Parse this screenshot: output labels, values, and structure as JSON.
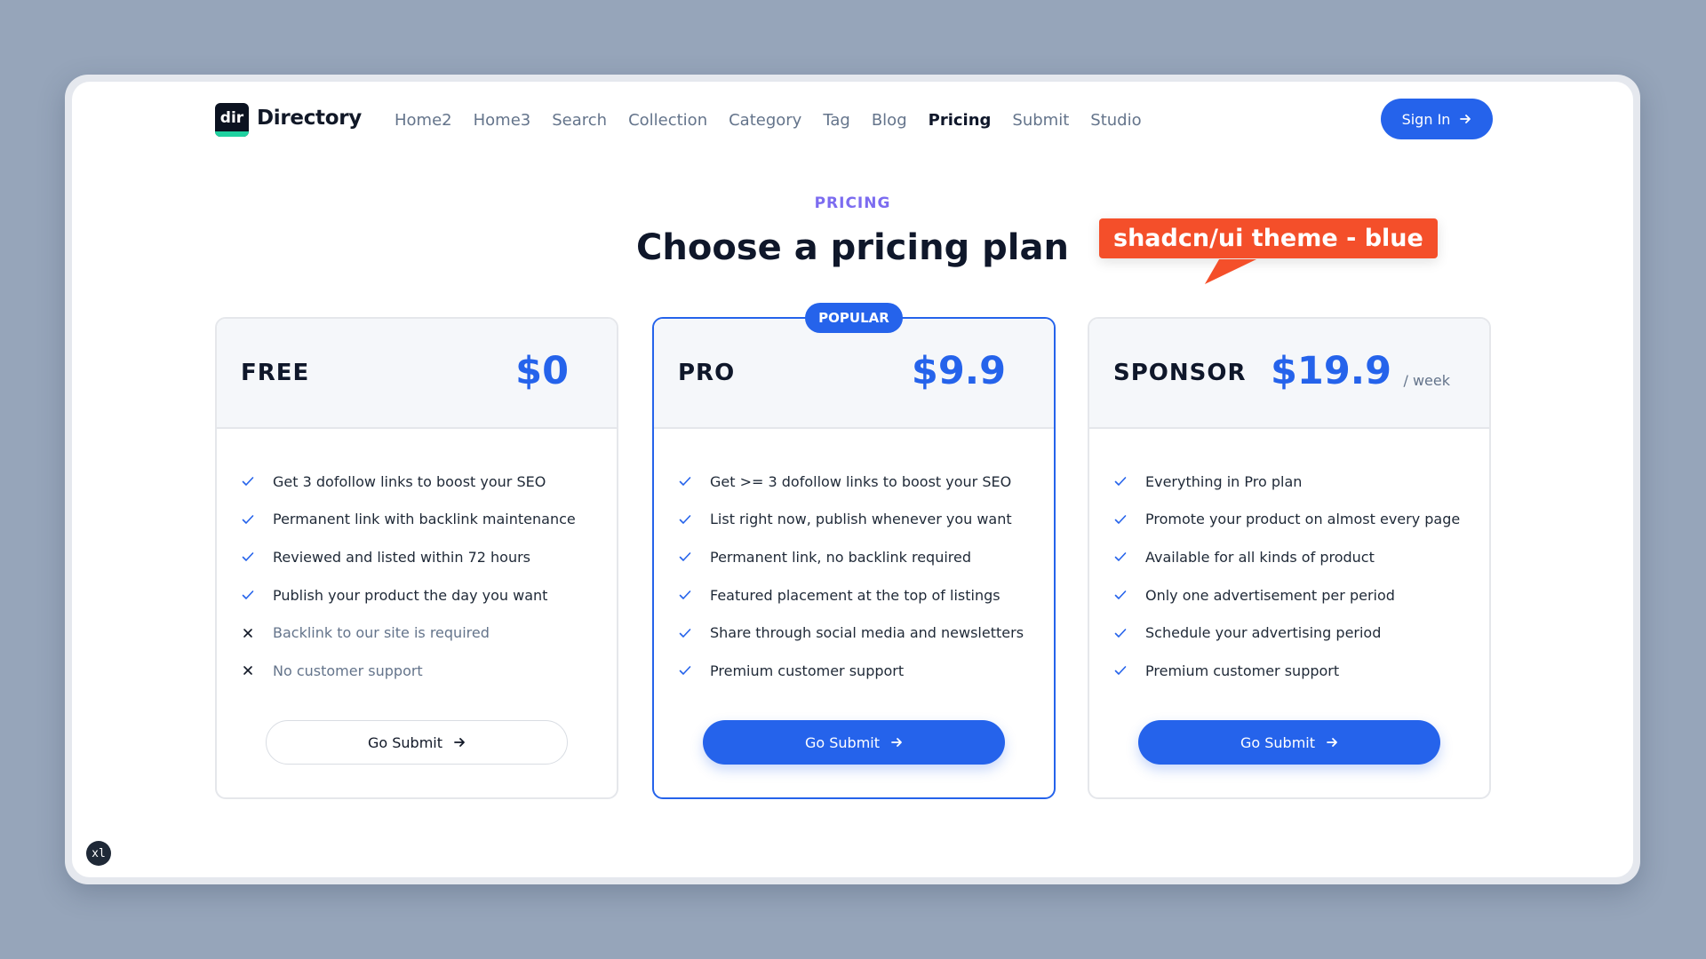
{
  "brand": {
    "logo_text": "dir",
    "name": "Directory"
  },
  "nav": {
    "items": [
      {
        "label": "Home2"
      },
      {
        "label": "Home3"
      },
      {
        "label": "Search"
      },
      {
        "label": "Collection"
      },
      {
        "label": "Category"
      },
      {
        "label": "Tag"
      },
      {
        "label": "Blog"
      },
      {
        "label": "Pricing",
        "active": true
      },
      {
        "label": "Submit"
      },
      {
        "label": "Studio"
      }
    ],
    "signin_label": "Sign In"
  },
  "section": {
    "eyebrow": "PRICING",
    "title": "Choose a pricing plan"
  },
  "callout": "shadcn/ui theme - blue",
  "plans": [
    {
      "name": "FREE",
      "price": "$0",
      "features": [
        {
          "text": "Get 3 dofollow links to boost your SEO",
          "included": true
        },
        {
          "text": "Permanent link with backlink maintenance",
          "included": true
        },
        {
          "text": "Reviewed and listed within 72 hours",
          "included": true
        },
        {
          "text": "Publish your product the day you want",
          "included": true
        },
        {
          "text": "Backlink to our site is required",
          "included": false
        },
        {
          "text": "No customer support",
          "included": false
        }
      ],
      "cta": "Go Submit"
    },
    {
      "name": "PRO",
      "price": "$9.9",
      "badge": "POPULAR",
      "features": [
        {
          "text": "Get >= 3 dofollow links to boost your SEO",
          "included": true
        },
        {
          "text": "List right now, publish whenever you want",
          "included": true
        },
        {
          "text": "Permanent link, no backlink required",
          "included": true
        },
        {
          "text": "Featured placement at the top of listings",
          "included": true
        },
        {
          "text": "Share through social media and newsletters",
          "included": true
        },
        {
          "text": "Premium customer support",
          "included": true
        }
      ],
      "cta": "Go Submit"
    },
    {
      "name": "SPONSOR",
      "price": "$19.9",
      "period": "/ week",
      "features": [
        {
          "text": "Everything in Pro plan",
          "included": true
        },
        {
          "text": "Promote your product on almost every page",
          "included": true
        },
        {
          "text": "Available for all kinds of product",
          "included": true
        },
        {
          "text": "Only one advertisement per period",
          "included": true
        },
        {
          "text": "Schedule your advertising period",
          "included": true
        },
        {
          "text": "Premium customer support",
          "included": true
        }
      ],
      "cta": "Go Submit"
    }
  ],
  "corner_badge": "xl",
  "colors": {
    "accent": "#2563eb",
    "eyebrow": "#7c6cf0",
    "callout": "#f44f2a",
    "backdrop": "#96a5ba"
  },
  "icons": {
    "check": "check-icon",
    "cross": "x-icon",
    "arrow": "arrow-right-icon"
  }
}
